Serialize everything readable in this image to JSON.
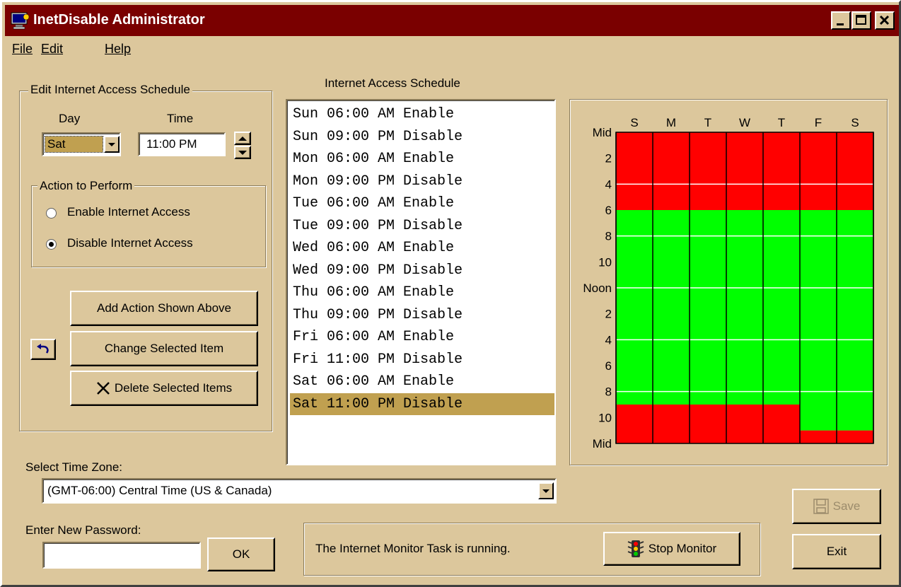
{
  "window": {
    "title": "InetDisable Administrator"
  },
  "menu": [
    "File",
    "Edit",
    "Help"
  ],
  "edit_group": {
    "legend": "Edit Internet Access Schedule",
    "day_label": "Day",
    "time_label": "Time",
    "day_value": "Sat",
    "time_value": "11:00 PM"
  },
  "action_group": {
    "legend": "Action to Perform",
    "enable_label": "Enable Internet Access",
    "disable_label": "Disable Internet Access",
    "selected": "disable"
  },
  "buttons": {
    "add": "Add Action Shown Above",
    "change": "Change Selected Item",
    "delete": "Delete Selected Items",
    "ok": "OK",
    "stop_monitor": "Stop Monitor",
    "save": "Save",
    "exit": "Exit"
  },
  "schedule": {
    "header": "Internet Access Schedule",
    "items": [
      "Sun 06:00 AM Enable",
      "Sun 09:00 PM Disable",
      "Mon 06:00 AM Enable",
      "Mon 09:00 PM Disable",
      "Tue 06:00 AM Enable",
      "Tue 09:00 PM Disable",
      "Wed 06:00 AM Enable",
      "Wed 09:00 PM Disable",
      "Thu 06:00 AM Enable",
      "Thu 09:00 PM Disable",
      "Fri 06:00 AM Enable",
      "Fri 11:00 PM Disable",
      "Sat 06:00 AM Enable",
      "Sat 11:00 PM Disable"
    ],
    "selected_index": 13
  },
  "chart": {
    "day_labels": [
      "S",
      "M",
      "T",
      "W",
      "T",
      "F",
      "S"
    ],
    "hour_labels": [
      "Mid",
      "2",
      "4",
      "6",
      "8",
      "10",
      "Noon",
      "2",
      "4",
      "6",
      "8",
      "10",
      "Mid"
    ],
    "enabled_ranges_hours": [
      [
        6,
        21
      ],
      [
        6,
        21
      ],
      [
        6,
        21
      ],
      [
        6,
        21
      ],
      [
        6,
        21
      ],
      [
        6,
        23
      ],
      [
        6,
        23
      ]
    ],
    "enabled_color": "#00ff00",
    "disabled_color": "#ff0000"
  },
  "timezone": {
    "label": "Select Time Zone:",
    "value": "(GMT-06:00) Central Time (US & Canada)"
  },
  "password": {
    "label": "Enter New Password:",
    "value": ""
  },
  "status": {
    "text": "The Internet Monitor Task is running."
  }
}
